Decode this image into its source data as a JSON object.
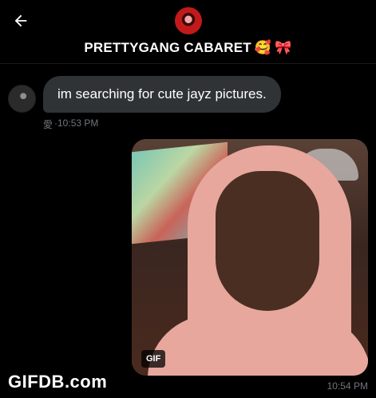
{
  "header": {
    "back_icon": "arrow-left-icon",
    "group_name": "PRETTYGANG CABARET",
    "group_emojis": [
      "🥰",
      "🎀"
    ]
  },
  "messages": [
    {
      "sender_side": "left",
      "text": "im searching for cute jayz pictures.",
      "sender_mark": "愛",
      "time": "·10:53 PM"
    },
    {
      "sender_side": "right",
      "type": "gif",
      "badge": "GIF",
      "time": "10:54 PM"
    }
  ],
  "watermark": "GIFDB.com",
  "colors": {
    "background": "#000000",
    "bubble": "#2f3336",
    "meta_text": "#71767b",
    "hood_pink": "#e7a79d"
  }
}
